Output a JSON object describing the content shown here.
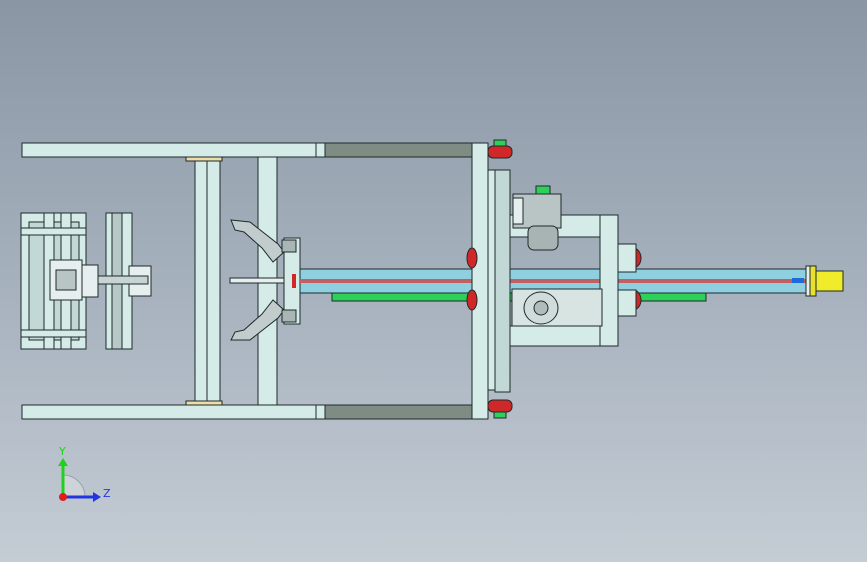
{
  "triad": {
    "y_label": "Y",
    "z_label": "Z",
    "colors": {
      "y": "#1fd01f",
      "z": "#2335e0",
      "x": "#e01e1e"
    }
  },
  "colors": {
    "background_top": "#8a96a4",
    "background_bottom": "#c4ccd4",
    "frame": "#d5ebe8",
    "frame_edge": "#1e2a2a",
    "dark_bar": "#7f8c84",
    "shaft": "#8ecfe0",
    "rod": "#c06060",
    "rack": "#2fd05a",
    "red_part": "#d02828",
    "green_part": "#2fd05a",
    "yellow_tip": "#f0ec2a",
    "blue_tip": "#1f6ad8",
    "motor": "#b9c4c4"
  }
}
